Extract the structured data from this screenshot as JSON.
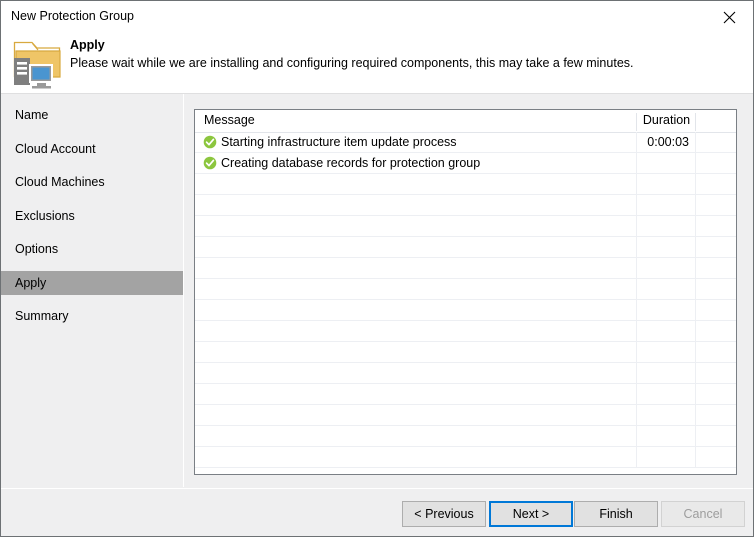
{
  "window": {
    "title": "New Protection Group",
    "close_icon": "close-x-icon"
  },
  "header": {
    "icon": "protection-group-folder-icon",
    "title": "Apply",
    "subtitle": "Please wait while we are installing and configuring required components, this may take a few minutes."
  },
  "sidebar": {
    "items": [
      {
        "label": "Name",
        "selected": false
      },
      {
        "label": "Cloud Account",
        "selected": false
      },
      {
        "label": "Cloud Machines",
        "selected": false
      },
      {
        "label": "Exclusions",
        "selected": false
      },
      {
        "label": "Options",
        "selected": false
      },
      {
        "label": "Apply",
        "selected": true
      },
      {
        "label": "Summary",
        "selected": false
      }
    ]
  },
  "grid": {
    "columns": [
      "Message",
      "Duration"
    ],
    "rows": [
      {
        "icon": "success-check-icon",
        "message": "Starting infrastructure item update process",
        "duration": "0:00:03"
      },
      {
        "icon": "success-check-icon",
        "message": "Creating database records for protection group",
        "duration": ""
      }
    ],
    "empty_row_count": 14
  },
  "footer": {
    "buttons": [
      {
        "label": "< Previous",
        "state": "enabled"
      },
      {
        "label": "Next >",
        "state": "focused"
      },
      {
        "label": "Finish",
        "state": "enabled"
      },
      {
        "label": "Cancel",
        "state": "disabled"
      }
    ]
  },
  "colors": {
    "accent": "#0078d7",
    "success": "#8cc63e",
    "selection": "#a3a3a3",
    "dialog_bg": "#efeff0",
    "folder": "#efc567"
  }
}
